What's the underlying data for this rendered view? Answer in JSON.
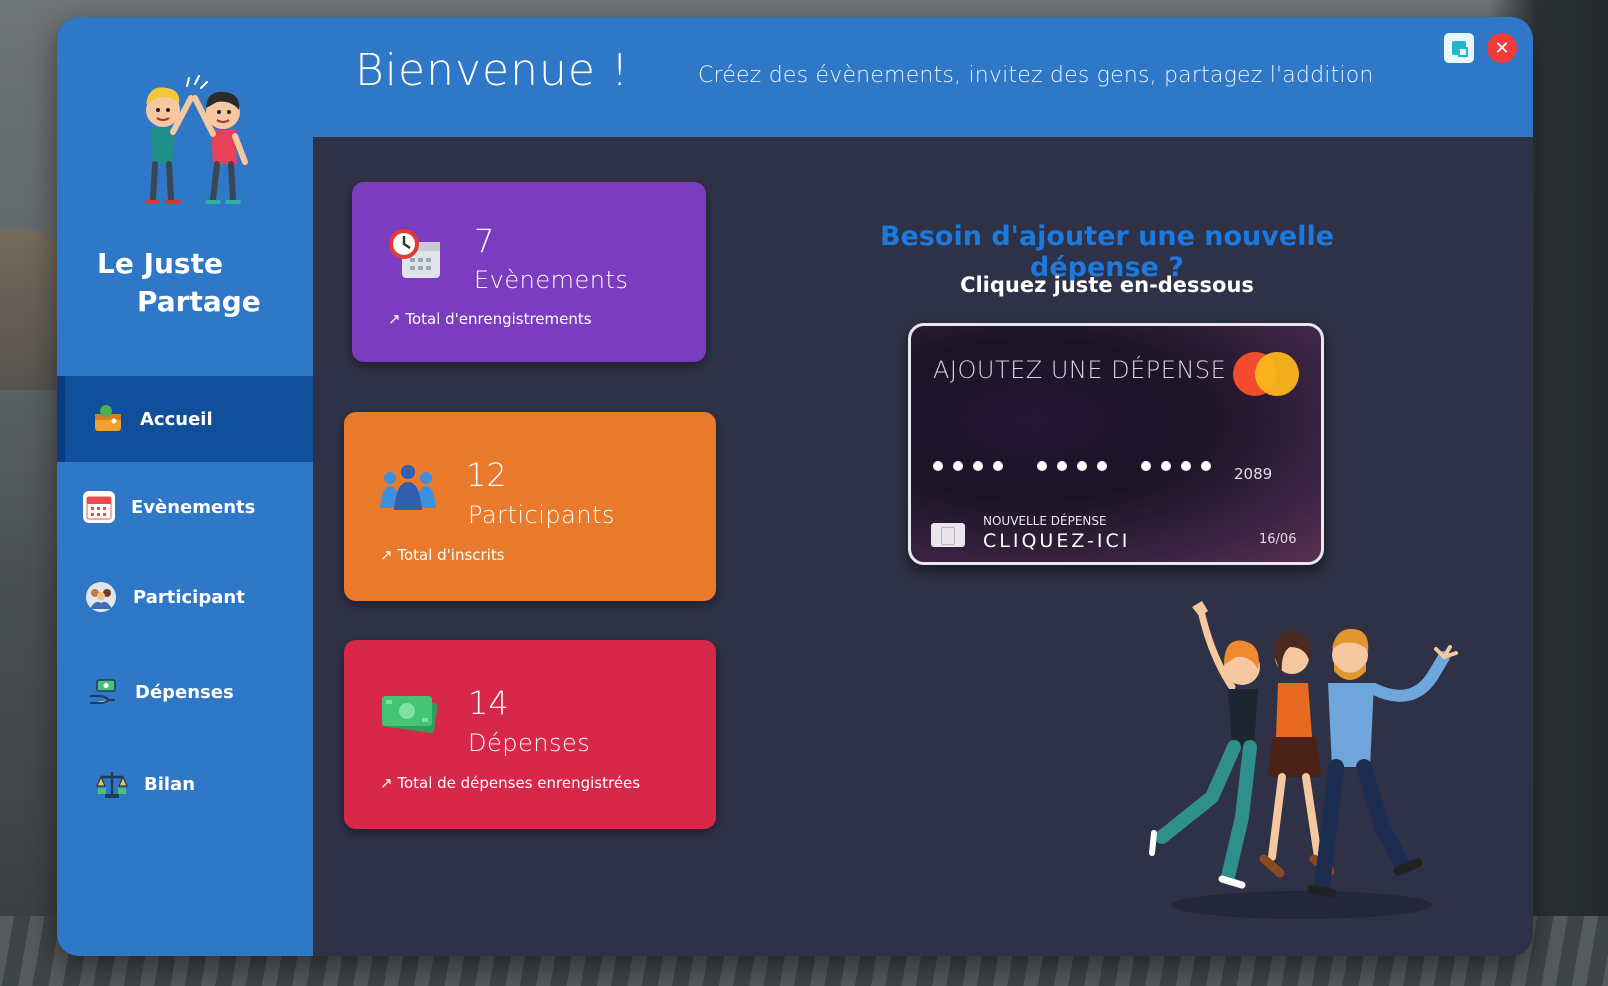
{
  "window": {
    "title": "Bienvenue !",
    "subtitle": "Créez des évènements, invitez des gens, partagez l'addition"
  },
  "brand": {
    "line1": "Le Juste",
    "line2": "Partage"
  },
  "sidebar": {
    "items": [
      {
        "label": "Accueil",
        "icon": "wallet-icon",
        "active": true
      },
      {
        "label": "Evènements",
        "icon": "calendar-icon",
        "active": false
      },
      {
        "label": "Participant",
        "icon": "people-icon",
        "active": false
      },
      {
        "label": "Dépenses",
        "icon": "money-hand-icon",
        "active": false
      },
      {
        "label": "Bilan",
        "icon": "balance-icon",
        "active": false
      }
    ]
  },
  "stats": [
    {
      "value": "7",
      "label": "Evènements",
      "footer": "↗ Total d'enrengistrements",
      "color": "#7b3cbf"
    },
    {
      "value": "12",
      "label": "Participants",
      "footer": "↗ Total d'inscrits",
      "color": "#e97a2c"
    },
    {
      "value": "14",
      "label": "Dépenses",
      "footer": "↗ Total de dépenses enrengistrées",
      "color": "#d8284a"
    }
  ],
  "cta": {
    "title": "Besoin d'ajouter une nouvelle dépense ?",
    "subtitle": "Cliquez juste en-dessous"
  },
  "card": {
    "title": "AJOUTEZ UNE DÉPENSE",
    "last4": "2089",
    "caption": "NOUVELLE DÉPENSE",
    "action": "CLIQUEZ-ICI",
    "expiry": "16/06"
  },
  "colors": {
    "sidebar": "#2f77c7",
    "active_nav": "#0f4f9b",
    "content_bg": "#2f3146",
    "accent_blue": "#1a7ae0"
  }
}
